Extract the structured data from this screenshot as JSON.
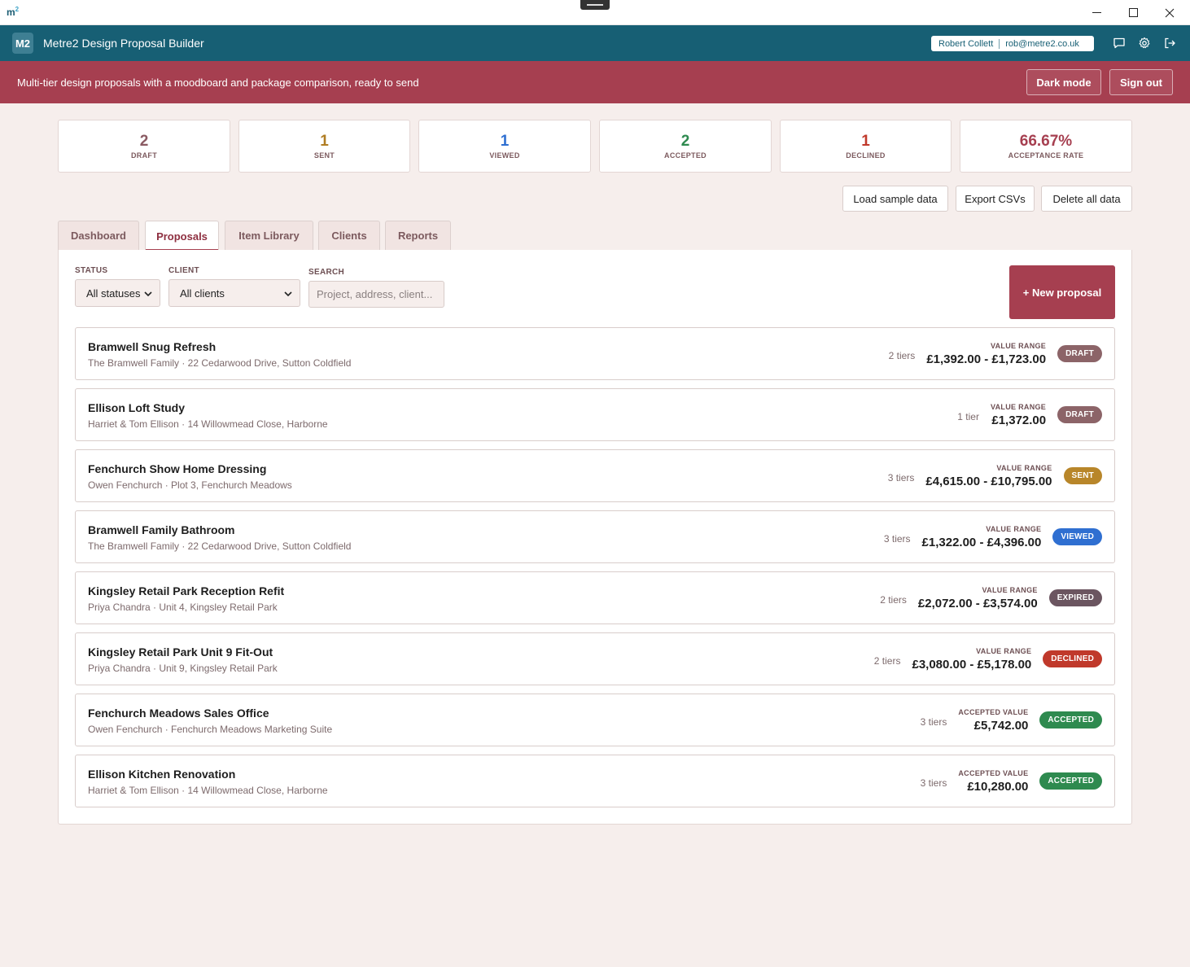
{
  "window": {
    "logo": "m",
    "logo_sup": "2"
  },
  "header": {
    "badge": "M2",
    "title": "Metre2 Design Proposal Builder",
    "user_name": "Robert Collett",
    "user_email": "rob@metre2.co.uk"
  },
  "banner": {
    "tagline": "Multi-tier design proposals with a moodboard and package comparison, ready to send",
    "dark_mode": "Dark mode",
    "sign_out": "Sign out"
  },
  "stats": [
    {
      "value": "2",
      "label": "DRAFT",
      "color": "#8a5a62"
    },
    {
      "value": "1",
      "label": "SENT",
      "color": "#b07d23"
    },
    {
      "value": "1",
      "label": "VIEWED",
      "color": "#2f6fd1"
    },
    {
      "value": "2",
      "label": "ACCEPTED",
      "color": "#2e8a4f"
    },
    {
      "value": "1",
      "label": "DECLINED",
      "color": "#c0392b"
    },
    {
      "value": "66.67%",
      "label": "ACCEPTANCE RATE",
      "color": "#a63f50"
    }
  ],
  "actions": {
    "load": "Load sample data",
    "export": "Export CSVs",
    "delete": "Delete all data"
  },
  "tabs": [
    {
      "label": "Dashboard"
    },
    {
      "label": "Proposals"
    },
    {
      "label": "Item Library"
    },
    {
      "label": "Clients"
    },
    {
      "label": "Reports"
    }
  ],
  "filters": {
    "status_label": "STATUS",
    "status_value": "All statuses",
    "client_label": "CLIENT",
    "client_value": "All clients",
    "search_label": "SEARCH",
    "search_placeholder": "Project, address, client..."
  },
  "new_proposal": "+ New proposal",
  "colors": {
    "draft": "#8c6468",
    "sent": "#b8862a",
    "viewed": "#2f6fd1",
    "expired": "#6b5560",
    "declined": "#c0392b",
    "accepted": "#2e8a4f"
  },
  "proposals": [
    {
      "name": "Bramwell Snug Refresh",
      "sub": "The Bramwell Family · 22 Cedarwood Drive, Sutton Coldfield",
      "tiers": "2 tiers",
      "value_label": "VALUE RANGE",
      "value": "£1,392.00 - £1,723.00",
      "status": "DRAFT",
      "color": "#8c6468"
    },
    {
      "name": "Ellison Loft Study",
      "sub": "Harriet & Tom Ellison · 14 Willowmead Close, Harborne",
      "tiers": "1 tier",
      "value_label": "VALUE RANGE",
      "value": "£1,372.00",
      "status": "DRAFT",
      "color": "#8c6468"
    },
    {
      "name": "Fenchurch Show Home Dressing",
      "sub": "Owen Fenchurch · Plot 3, Fenchurch Meadows",
      "tiers": "3 tiers",
      "value_label": "VALUE RANGE",
      "value": "£4,615.00 - £10,795.00",
      "status": "SENT",
      "color": "#b8862a"
    },
    {
      "name": "Bramwell Family Bathroom",
      "sub": "The Bramwell Family · 22 Cedarwood Drive, Sutton Coldfield",
      "tiers": "3 tiers",
      "value_label": "VALUE RANGE",
      "value": "£1,322.00 - £4,396.00",
      "status": "VIEWED",
      "color": "#2f6fd1"
    },
    {
      "name": "Kingsley Retail Park Reception Refit",
      "sub": "Priya Chandra · Unit 4, Kingsley Retail Park",
      "tiers": "2 tiers",
      "value_label": "VALUE RANGE",
      "value": "£2,072.00 - £3,574.00",
      "status": "EXPIRED",
      "color": "#6b5560"
    },
    {
      "name": "Kingsley Retail Park Unit 9 Fit-Out",
      "sub": "Priya Chandra · Unit 9, Kingsley Retail Park",
      "tiers": "2 tiers",
      "value_label": "VALUE RANGE",
      "value": "£3,080.00 - £5,178.00",
      "status": "DECLINED",
      "color": "#c0392b"
    },
    {
      "name": "Fenchurch Meadows Sales Office",
      "sub": "Owen Fenchurch · Fenchurch Meadows Marketing Suite",
      "tiers": "3 tiers",
      "value_label": "ACCEPTED VALUE",
      "value": "£5,742.00",
      "status": "ACCEPTED",
      "color": "#2e8a4f"
    },
    {
      "name": "Ellison Kitchen Renovation",
      "sub": "Harriet & Tom Ellison · 14 Willowmead Close, Harborne",
      "tiers": "3 tiers",
      "value_label": "ACCEPTED VALUE",
      "value": "£10,280.00",
      "status": "ACCEPTED",
      "color": "#2e8a4f"
    }
  ]
}
